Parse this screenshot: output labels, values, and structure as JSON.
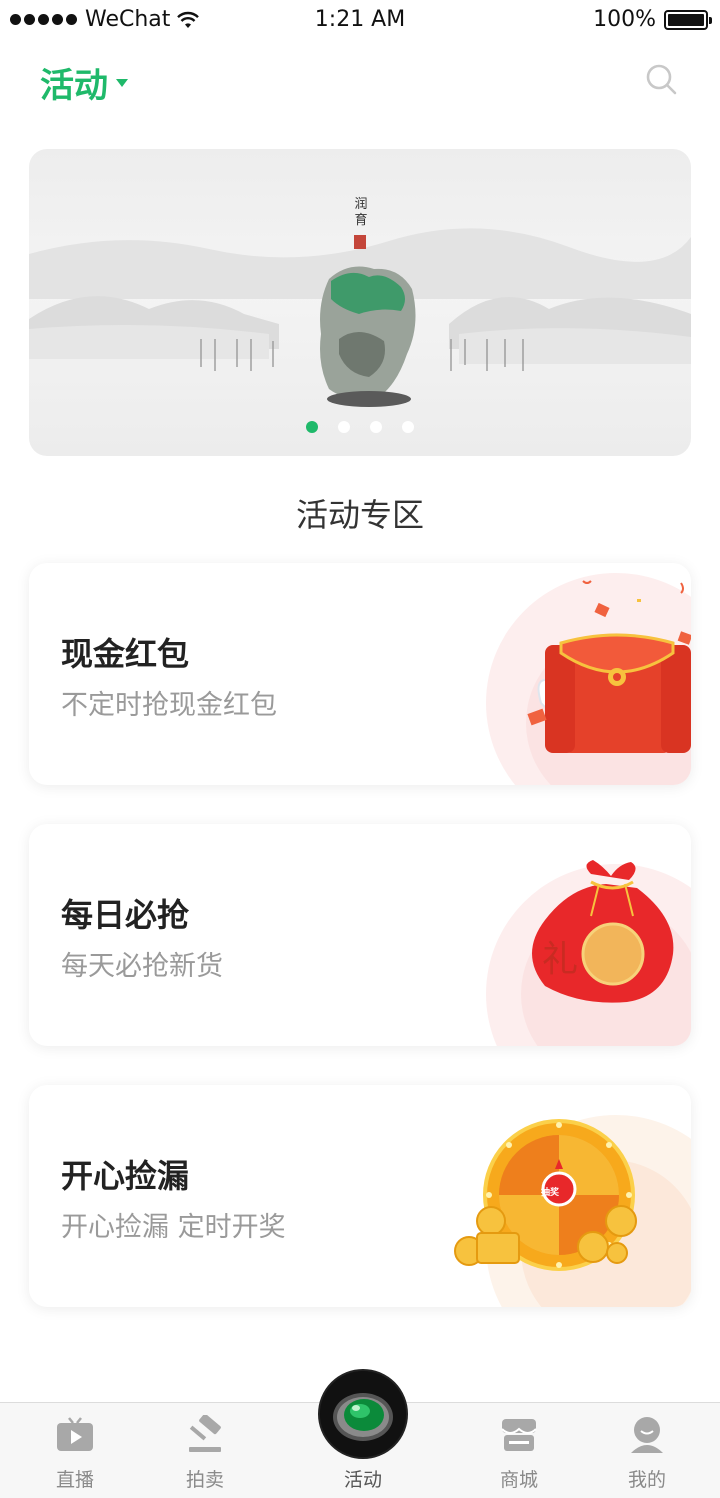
{
  "status_bar": {
    "carrier": "WeChat",
    "time": "1:21 AM",
    "battery": "100%"
  },
  "header": {
    "title": "活动",
    "accent_color": "#1fb96a"
  },
  "banner": {
    "slide_count": 4,
    "active_index": 0,
    "caption": "润育"
  },
  "section": {
    "title": "活动专区"
  },
  "cards": [
    {
      "title": "现金红包",
      "subtitle": "不定时抢现金红包",
      "icon": "red-envelope-icon"
    },
    {
      "title": "每日必抢",
      "subtitle": "每天必抢新货",
      "icon": "gift-bag-icon",
      "badge": "礼"
    },
    {
      "title": "开心捡漏",
      "subtitle": "开心捡漏 定时开奖",
      "icon": "lottery-wheel-icon",
      "badge": "抽奖"
    }
  ],
  "tabbar": {
    "items": [
      {
        "label": "直播",
        "icon": "tv-icon"
      },
      {
        "label": "拍卖",
        "icon": "gavel-icon"
      },
      {
        "label": "活动",
        "icon": "jade-ring-icon"
      },
      {
        "label": "商城",
        "icon": "store-icon"
      },
      {
        "label": "我的",
        "icon": "user-icon"
      }
    ],
    "active_index": 2
  }
}
